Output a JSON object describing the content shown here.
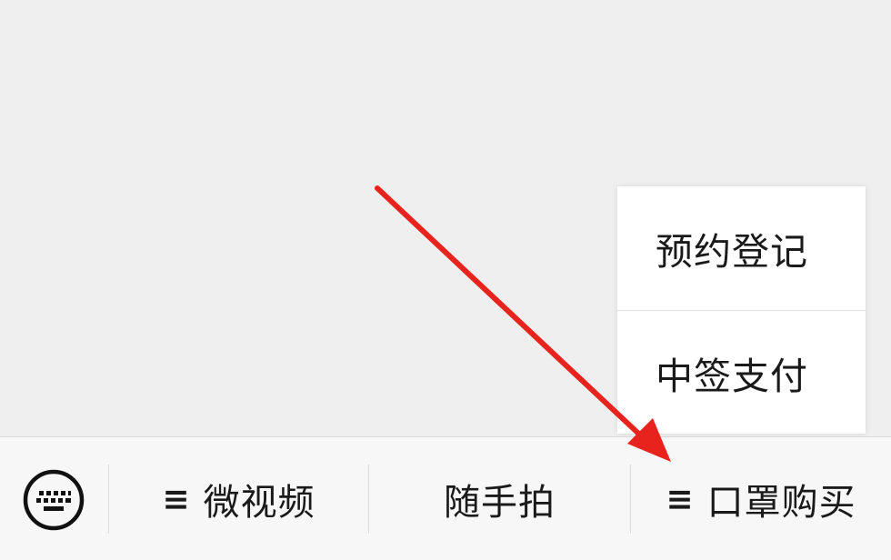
{
  "submenu": {
    "items": [
      {
        "label": "预约登记"
      },
      {
        "label": "中签支付"
      }
    ]
  },
  "menubar": {
    "keyboard_icon": "keyboard-icon",
    "buttons": [
      {
        "label": "微视频",
        "has_submenu": true
      },
      {
        "label": "随手拍",
        "has_submenu": false
      },
      {
        "label": "口罩购买",
        "has_submenu": true
      }
    ],
    "submenu_glyph": "≡"
  },
  "colors": {
    "background": "#efeff0",
    "menubar": "#f7f7f7",
    "arrow": "#e8231d",
    "text": "#1a1a1a"
  }
}
